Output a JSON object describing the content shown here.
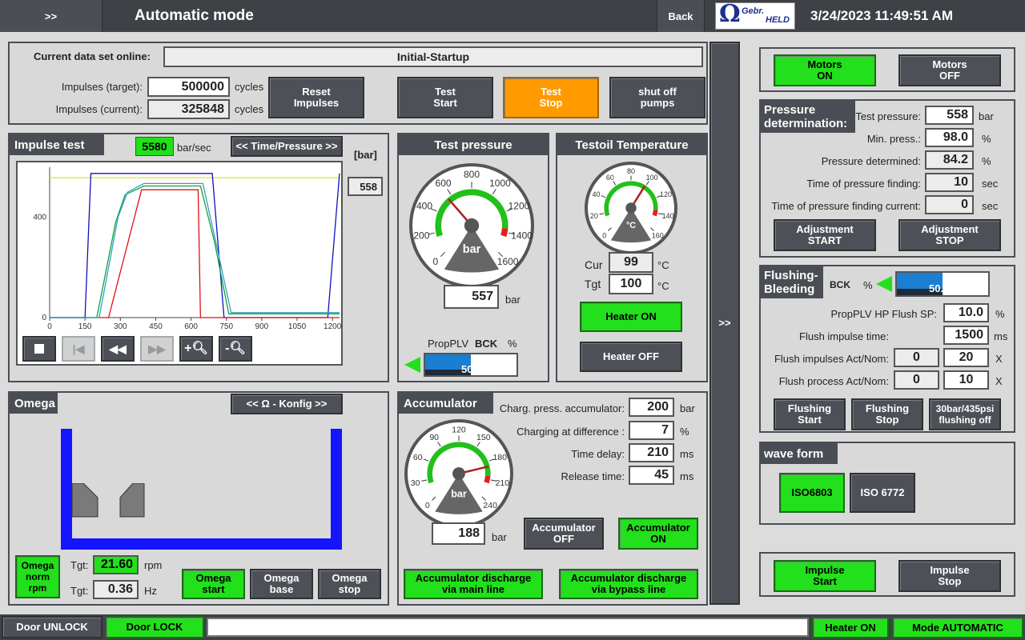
{
  "topbar": {
    "menu": ">>",
    "title": "Automatic mode",
    "back": "Back",
    "logo_top": "Gebr.",
    "logo_bottom": "HELD",
    "datetime": "3/24/2023 11:49:51 AM"
  },
  "dataset": {
    "label": "Current data set online:",
    "value": "Initial-Startup"
  },
  "impulses": {
    "target_label": "Impulses (target):",
    "target": "500000",
    "current_label": "Impulses (current):",
    "current": "325848",
    "unit": "cycles"
  },
  "buttons": {
    "reset": "Reset\nImpulses",
    "test_start": "Test\nStart",
    "test_stop": "Test\nStop",
    "shutoff": "shut off\npumps",
    "motors_on": "Motors\nON",
    "motors_off": "Motors\nOFF",
    "adj_start": "Adjustment\nSTART",
    "adj_stop": "Adjustment\nSTOP",
    "heater_on": "Heater ON",
    "heater_off": "Heater OFF",
    "acc_off": "Accumulator\nOFF",
    "acc_on": "Accumulator\nON",
    "acc_main": "Accumulator discharge\nvia main line",
    "acc_bypass": "Accumulator discharge\nvia bypass line",
    "omega_norm": "Omega\nnorm\nrpm",
    "omega_start": "Omega\nstart",
    "omega_base": "Omega\nbase",
    "omega_stop": "Omega\nstop",
    "flush_start": "Flushing\nStart",
    "flush_stop": "Flushing\nStop",
    "flush_off": "30bar/435psi\nflushing off",
    "iso6803": "ISO6803",
    "iso6772": "ISO 6772",
    "impulse_start": "Impulse\nStart",
    "impulse_stop": "Impulse\nStop",
    "side_toggle": ">>"
  },
  "impulse_test": {
    "title": "Impulse test",
    "rate": "5580",
    "rate_unit": "bar/sec",
    "toggle": "<< Time/Pressure >>",
    "unit": "[bar]",
    "current": "558"
  },
  "chart_data": {
    "type": "line",
    "xlim": [
      0,
      1230
    ],
    "ylim": [
      0,
      600
    ],
    "xticks": [
      0,
      150,
      300,
      450,
      600,
      750,
      900,
      1050,
      1200
    ],
    "yticks": [
      0,
      400
    ],
    "series": [
      {
        "color": "#1010c0",
        "x": [
          0,
          150,
          175,
          690,
          740,
          1180,
          1230
        ],
        "y": [
          0,
          0,
          575,
          575,
          0,
          0,
          575
        ]
      },
      {
        "color": "#e01010",
        "x": [
          0,
          250,
          390,
          630,
          640,
          1230
        ],
        "y": [
          0,
          0,
          510,
          510,
          0,
          0
        ]
      },
      {
        "color": "#10a040",
        "x": [
          0,
          200,
          280,
          320,
          400,
          640,
          700,
          760,
          1230
        ],
        "y": [
          0,
          0,
          380,
          490,
          525,
          525,
          300,
          15,
          15
        ]
      },
      {
        "color": "#30a0c0",
        "x": [
          0,
          210,
          290,
          330,
          400,
          650,
          710,
          770,
          1230
        ],
        "y": [
          0,
          0,
          400,
          500,
          535,
          535,
          280,
          20,
          20
        ]
      }
    ],
    "thresholds": [
      {
        "color": "#e6e61a",
        "y": 558
      }
    ]
  },
  "test_pressure": {
    "title": "Test pressure",
    "unit": "bar",
    "value": "557",
    "needle": 557,
    "max": 1600,
    "ticks": [
      "0",
      "200",
      "400",
      "600",
      "800",
      "1000",
      "1200",
      "1400",
      "1600"
    ],
    "prop_label": "PropPLV",
    "bck": "BCK",
    "pct": "%",
    "prop_value": "50.0",
    "prop_fill": 0.5
  },
  "testoil": {
    "title": "Testoil Temperature",
    "unit": "°C",
    "ticks": [
      "0",
      "20",
      "40",
      "60",
      "80",
      "100",
      "120",
      "140",
      "160"
    ],
    "needle": 99,
    "max": 160,
    "cur_label": "Cur",
    "cur": "99",
    "tgt_label": "Tgt",
    "tgt": "100"
  },
  "accumulator": {
    "title": "Accumulator",
    "unit": "bar",
    "value": "188",
    "needle": 188,
    "max": 240,
    "ticks": [
      "0",
      "30",
      "60",
      "90",
      "120",
      "150",
      "180",
      "210",
      "240"
    ],
    "charg_label": "Charg. press. accumulator:",
    "charg": "200",
    "charg_unit": "bar",
    "diff_label": "Charging at difference :",
    "diff": "7",
    "diff_unit": "%",
    "delay_label": "Time delay:",
    "delay": "210",
    "delay_unit": "ms",
    "release_label": "Release time:",
    "release": "45",
    "release_unit": "ms"
  },
  "omega": {
    "title": "Omega",
    "konfig": "<< Ω - Konfig >>",
    "tgt_label": "Tgt:",
    "rpm": "21.60",
    "rpm_unit": "rpm",
    "hz": "0.36",
    "hz_unit": "Hz"
  },
  "pressure_det": {
    "title": "Pressure\ndetermination:",
    "test_label": "Test pressure:",
    "test": "558",
    "test_unit": "bar",
    "min_label": "Min. press.:",
    "min": "98.0",
    "min_unit": "%",
    "det_label": "Pressure determined:",
    "det": "84.2",
    "det_unit": "%",
    "tpf_label": "Time of pressure finding:",
    "tpf": "10",
    "tpf_unit": "sec",
    "tpfc_label": "Time of pressure finding current:",
    "tpfc": "0",
    "tpfc_unit": "sec"
  },
  "flushing": {
    "title": "Flushing-\nBleeding",
    "bck": "BCK",
    "pct": "%",
    "value": "50.0",
    "fill": 0.5,
    "sp_label": "PropPLV HP Flush SP:",
    "sp": "10.0",
    "sp_unit": "%",
    "time_label": "Flush impulse time:",
    "time": "1500",
    "time_unit": "ms",
    "imp_label": "Flush impulses Act/Nom:",
    "imp_act": "0",
    "imp_nom": "20",
    "imp_unit": "X",
    "proc_label": "Flush process Act/Nom:",
    "proc_act": "0",
    "proc_nom": "10",
    "proc_unit": "X"
  },
  "waveform": {
    "title": "wave form"
  },
  "status": {
    "door_unlock": "Door UNLOCK",
    "door_lock": "Door LOCK",
    "heater": "Heater ON",
    "mode": "Mode AUTOMATIC"
  }
}
